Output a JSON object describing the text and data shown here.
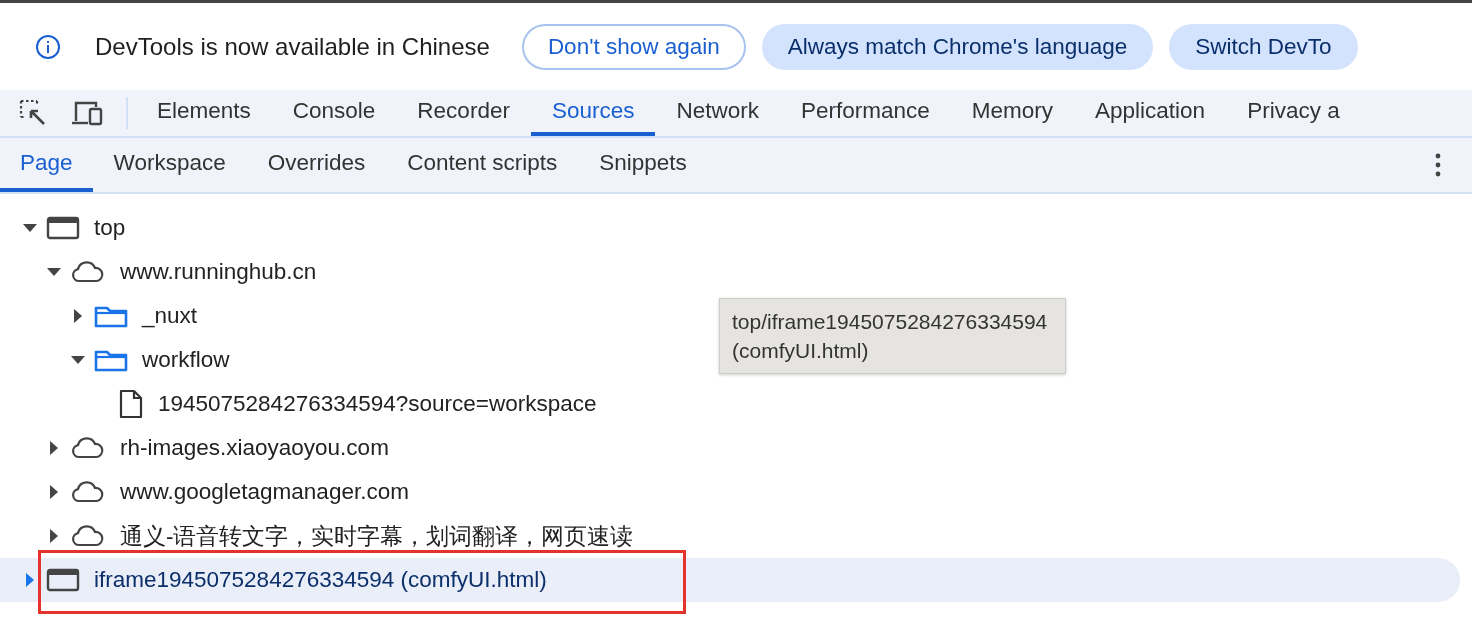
{
  "infobar": {
    "message": "DevTools is now available in Chinese",
    "buttons": [
      {
        "label": "Don't show again",
        "kind": "outline"
      },
      {
        "label": "Always match Chrome's language",
        "kind": "filled"
      },
      {
        "label": "Switch DevTo",
        "kind": "filled"
      }
    ]
  },
  "main_tabs": [
    {
      "label": "Elements",
      "selected": false
    },
    {
      "label": "Console",
      "selected": false
    },
    {
      "label": "Recorder",
      "selected": false
    },
    {
      "label": "Sources",
      "selected": true
    },
    {
      "label": "Network",
      "selected": false
    },
    {
      "label": "Performance",
      "selected": false
    },
    {
      "label": "Memory",
      "selected": false
    },
    {
      "label": "Application",
      "selected": false
    },
    {
      "label": "Privacy a",
      "selected": false
    }
  ],
  "sub_tabs": [
    {
      "label": "Page",
      "selected": true
    },
    {
      "label": "Workspace",
      "selected": false
    },
    {
      "label": "Overrides",
      "selected": false
    },
    {
      "label": "Content scripts",
      "selected": false
    },
    {
      "label": "Snippets",
      "selected": false
    }
  ],
  "tree": [
    {
      "label": "top",
      "kind": "frame",
      "expanded": true,
      "selected": false,
      "children": [
        {
          "label": "www.runninghub.cn",
          "kind": "domain",
          "expanded": true,
          "selected": false,
          "children": [
            {
              "label": "_nuxt",
              "kind": "folder",
              "expanded": false,
              "selected": false
            },
            {
              "label": "workflow",
              "kind": "folder",
              "expanded": true,
              "selected": false,
              "children": [
                {
                  "label": "1945075284276334594?source=workspace",
                  "kind": "file",
                  "selected": false
                }
              ]
            }
          ]
        },
        {
          "label": "rh-images.xiaoyaoyou.com",
          "kind": "domain",
          "expanded": false,
          "selected": false
        },
        {
          "label": "www.googletagmanager.com",
          "kind": "domain",
          "expanded": false,
          "selected": false
        },
        {
          "label": "通义-语音转文字，实时字幕，划词翻译，网页速读",
          "kind": "domain",
          "expanded": false,
          "selected": false
        }
      ]
    },
    {
      "label": "iframe1945075284276334594 (comfyUI.html)",
      "kind": "frame",
      "expanded": false,
      "selected": true
    }
  ],
  "tooltip": {
    "lines": [
      "top/iframe1945075284276334594",
      "(comfyUI.html)"
    ]
  },
  "annotation": {
    "kind": "rectangle",
    "color": "#e5322d"
  }
}
